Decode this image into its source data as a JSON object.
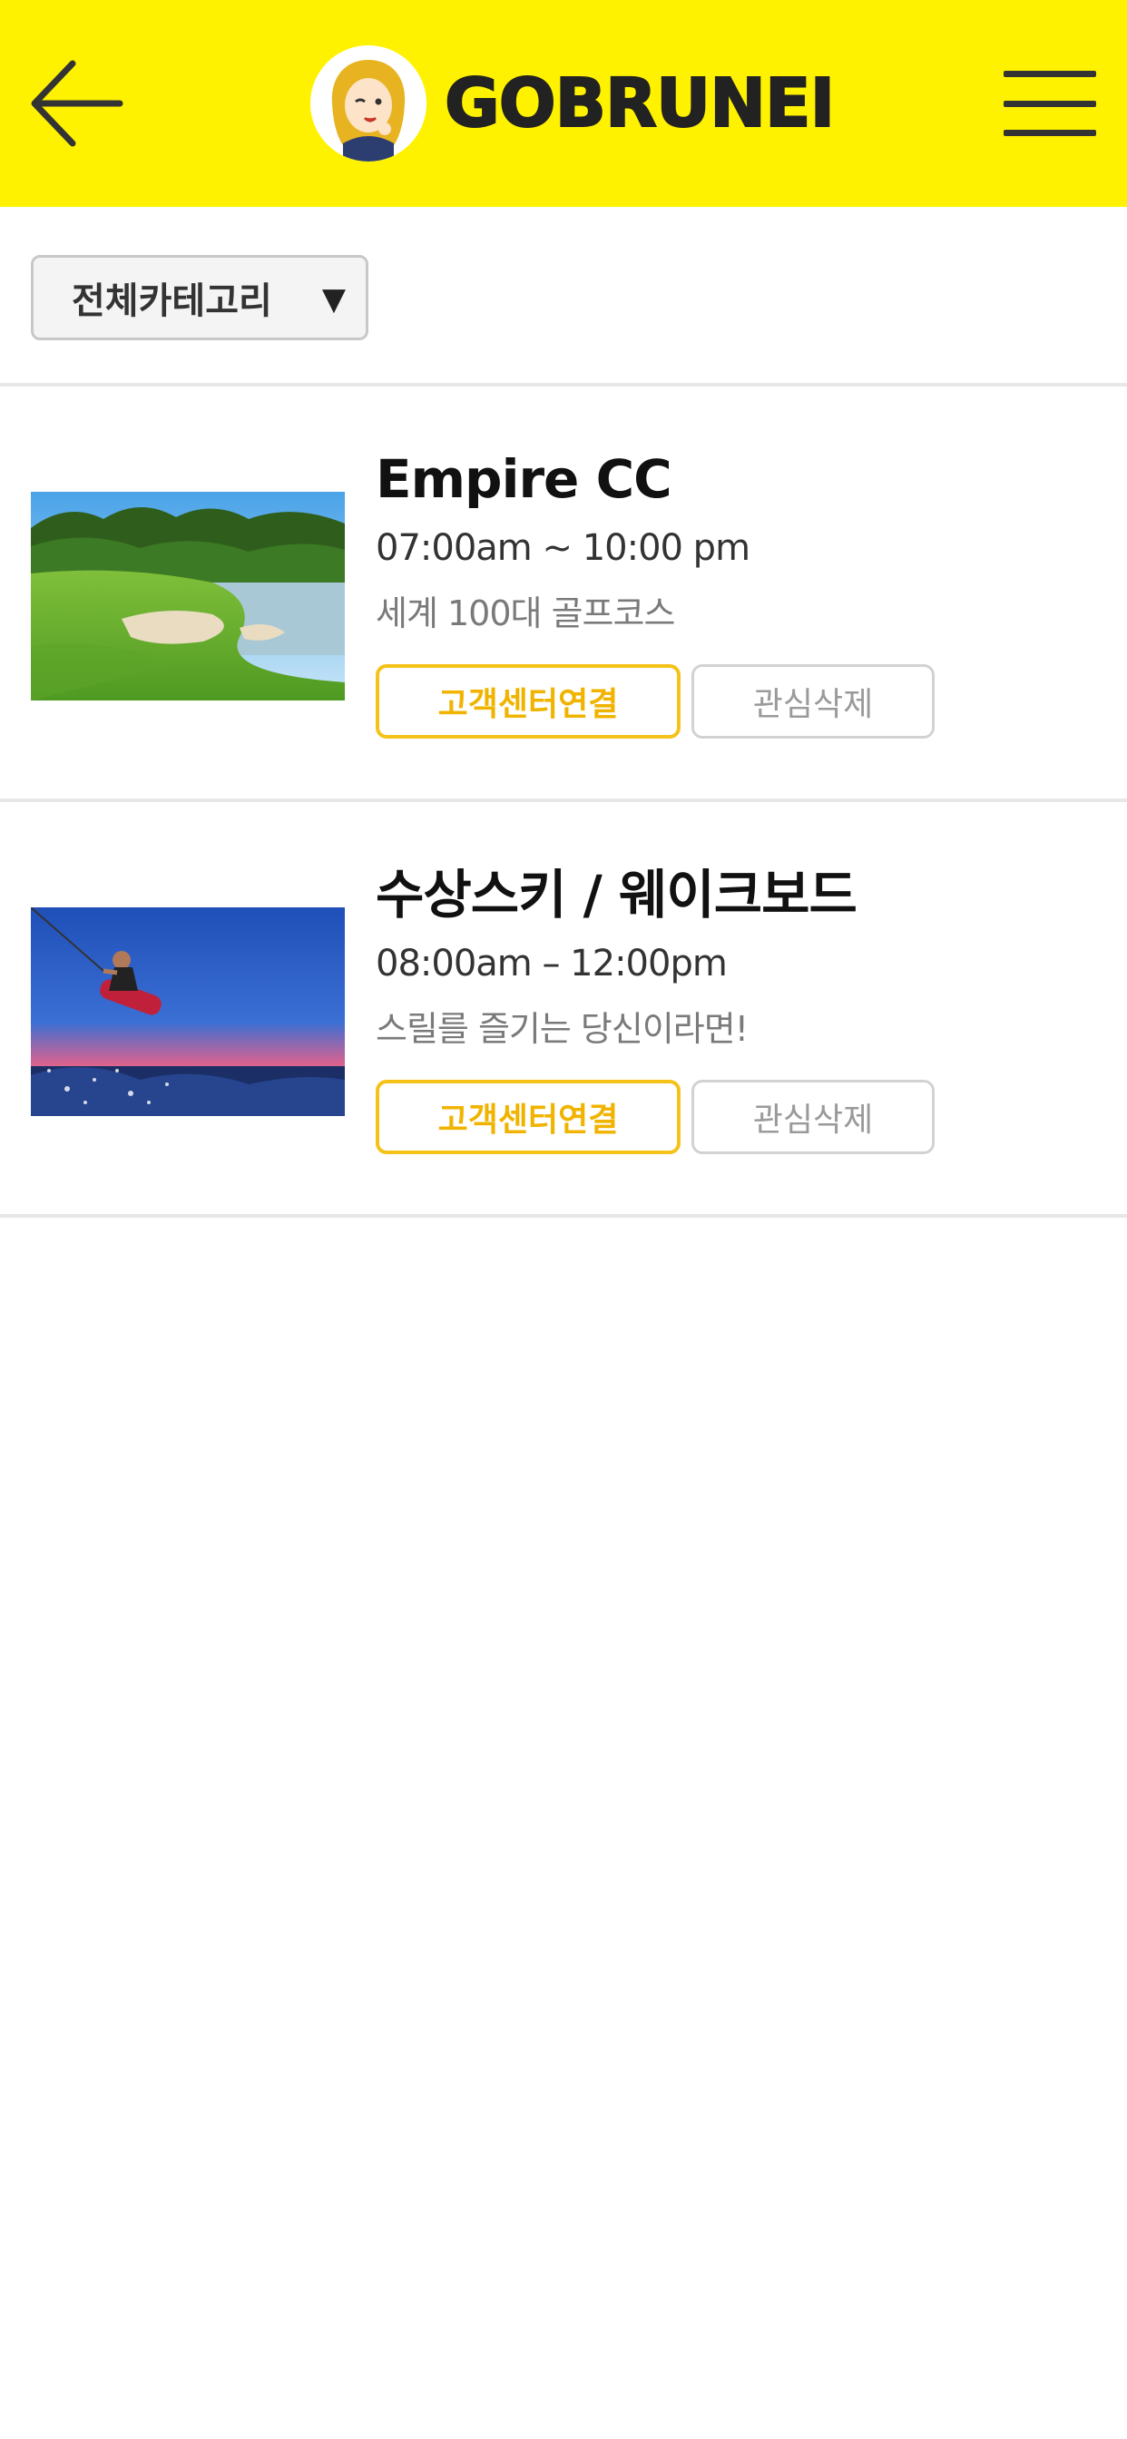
{
  "header": {
    "back_icon": "back-arrow-icon",
    "brand": "GOBRUNEI",
    "menu_icon": "hamburger-menu-icon",
    "background_color": "#fff200"
  },
  "filter": {
    "category_label": "전체카테고리",
    "dropdown_icon": "triangle-down-icon"
  },
  "items": [
    {
      "title": "Empire CC",
      "hours": "07:00am ~ 10:00 pm",
      "description": "세계 100대 골프코스",
      "contact_label": "고객센터연결",
      "remove_label": "관심삭제",
      "image": "golf-course-image"
    },
    {
      "title": "수상스키 / 웨이크보드",
      "hours": "08:00am – 12:00pm",
      "description": "스릴를 즐기는 당신이라면!",
      "contact_label": "고객센터연결",
      "remove_label": "관심삭제",
      "image": "wakeboard-image"
    }
  ],
  "colors": {
    "accent": "#f5c21a",
    "accent_text": "#f0b400",
    "divider": "#e7e7e7"
  }
}
